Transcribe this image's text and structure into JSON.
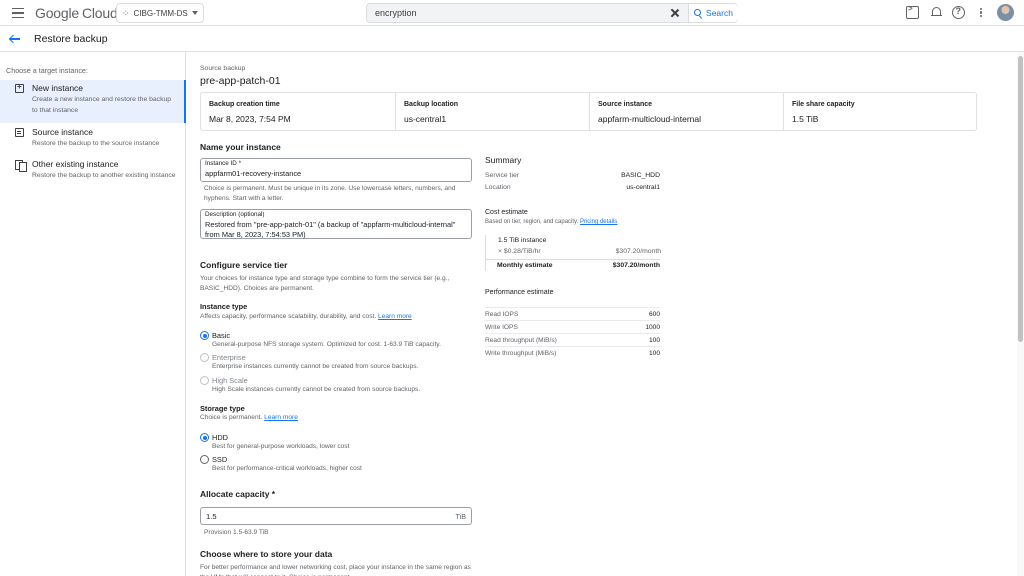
{
  "topbar": {
    "logo_google": "Google",
    "logo_cloud": "Cloud",
    "project": "CIBG-TMM-DS",
    "search_value": "encryption",
    "search_button": "Search"
  },
  "titlebar": {
    "title": "Restore backup"
  },
  "left": {
    "heading": "Choose a target instance:",
    "options": [
      {
        "title": "New instance",
        "desc": "Create a new instance and restore the backup to that instance"
      },
      {
        "title": "Source instance",
        "desc": "Restore the backup to the source instance"
      },
      {
        "title": "Other existing instance",
        "desc": "Restore the backup to another existing instance"
      }
    ]
  },
  "source": {
    "label": "Source backup",
    "name": "pre-app-patch-01",
    "columns": [
      {
        "header": "Backup creation time",
        "value": "Mar 8, 2023, 7:54 PM"
      },
      {
        "header": "Backup location",
        "value": "us-central1"
      },
      {
        "header": "Source instance",
        "value": "appfarm-multicloud-internal"
      },
      {
        "header": "File share capacity",
        "value": "1.5 TiB"
      }
    ]
  },
  "name_section": {
    "title": "Name your instance",
    "instance_id_label": "Instance ID *",
    "instance_id_value": "appfarm01-recovery-instance",
    "instance_id_hint": "Choice is permanent. Must be unique in its zone. Use lowercase letters, numbers, and hyphens. Start with a letter.",
    "description_label": "Description (optional)",
    "description_value": "Restored from \"pre-app-patch-01\" (a backup of \"appfarm-multicloud-internal\" from Mar 8, 2023, 7:54:53 PM)"
  },
  "tier": {
    "title": "Configure service tier",
    "desc": "Your choices for instance type and storage type combine to form the service tier (e.g., BASIC_HDD). Choices are permanent.",
    "instance_type_title": "Instance type",
    "instance_type_desc": "Affects capacity, performance scalability, durability, and cost.",
    "learn_more": "Learn more",
    "instance_types": [
      {
        "title": "Basic",
        "desc": "General-purpose NFS storage system. Optimized for cost. 1-63.9 TiB capacity."
      },
      {
        "title": "Enterprise",
        "desc": "Enterprise instances currently cannot be created from source backups."
      },
      {
        "title": "High Scale",
        "desc": "High Scale instances currently cannot be created from source backups."
      }
    ],
    "storage_type_title": "Storage type",
    "storage_type_desc": "Choice is permanent.",
    "storage_types": [
      {
        "title": "HDD",
        "desc": "Best for general-purpose workloads, lower cost"
      },
      {
        "title": "SSD",
        "desc": "Best for performance-critical workloads, higher cost"
      }
    ]
  },
  "capacity": {
    "title": "Allocate capacity *",
    "value": "1.5",
    "unit": "TiB",
    "hint": "Provision 1.5-63.9 TiB"
  },
  "region": {
    "title": "Choose where to store your data",
    "desc": "For better performance and lower networking cost, place your instance in the same region as the VMs that will connect to it. Choice is permanent."
  },
  "summary": {
    "title": "Summary",
    "rows": [
      {
        "k": "Service tier",
        "v": "BASIC_HDD"
      },
      {
        "k": "Location",
        "v": "us-central1"
      }
    ],
    "cost_title": "Cost estimate",
    "cost_sub": "Based on tier, region, and capacity.",
    "pricing_link": "Pricing details",
    "cost_line1": "1.5 TiB instance",
    "cost_line2_k": "× $0.28/TiB/hr",
    "cost_line2_v": "$307.20/month",
    "total_k": "Monthly estimate",
    "total_v": "$307.20/month",
    "perf_title": "Performance estimate",
    "perf": [
      {
        "k": "Read IOPS",
        "v": "600"
      },
      {
        "k": "Write IOPS",
        "v": "1000"
      },
      {
        "k": "Read throughput (MiB/s)",
        "v": "100"
      },
      {
        "k": "Write throughput (MiB/s)",
        "v": "100"
      }
    ]
  }
}
